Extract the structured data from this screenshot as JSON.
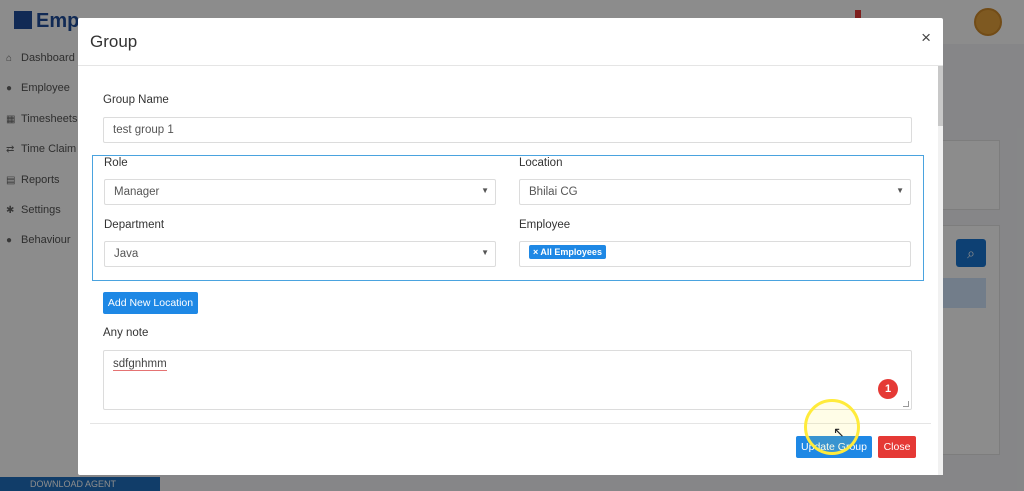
{
  "background": {
    "sidebar": [
      {
        "label": "Dashboard",
        "icon": "home-icon",
        "glyph": "⌂"
      },
      {
        "label": "Employee",
        "icon": "user-icon",
        "glyph": "●"
      },
      {
        "label": "Timesheets",
        "icon": "calendar-icon",
        "glyph": "▦"
      },
      {
        "label": "Time Claim",
        "icon": "exchange-icon",
        "glyph": "⇄"
      },
      {
        "label": "Reports",
        "icon": "report-icon",
        "glyph": "▤"
      },
      {
        "label": "Settings",
        "icon": "gear-icon",
        "glyph": "✱"
      },
      {
        "label": "Behaviour",
        "icon": "users-icon",
        "glyph": "●"
      }
    ],
    "download_label": "DOWNLOAD AGENT"
  },
  "modal": {
    "title": "Group",
    "close_glyph": "×",
    "group_name": {
      "label": "Group Name",
      "value": "test group 1"
    },
    "role": {
      "label": "Role",
      "value": "Manager"
    },
    "location": {
      "label": "Location",
      "value": "Bhilai CG"
    },
    "department": {
      "label": "Department",
      "value": "Java"
    },
    "employee": {
      "label": "Employee",
      "tag": "× All Employees"
    },
    "add_location_label": "Add New Location",
    "note": {
      "label": "Any note",
      "value": "sdfgnhmm"
    },
    "notification_count": "1",
    "update_label": "Update Group",
    "close_label": "Close"
  },
  "colors": {
    "primary": "#1e88e5",
    "danger": "#e53935",
    "location_border": "#4aa3df"
  }
}
